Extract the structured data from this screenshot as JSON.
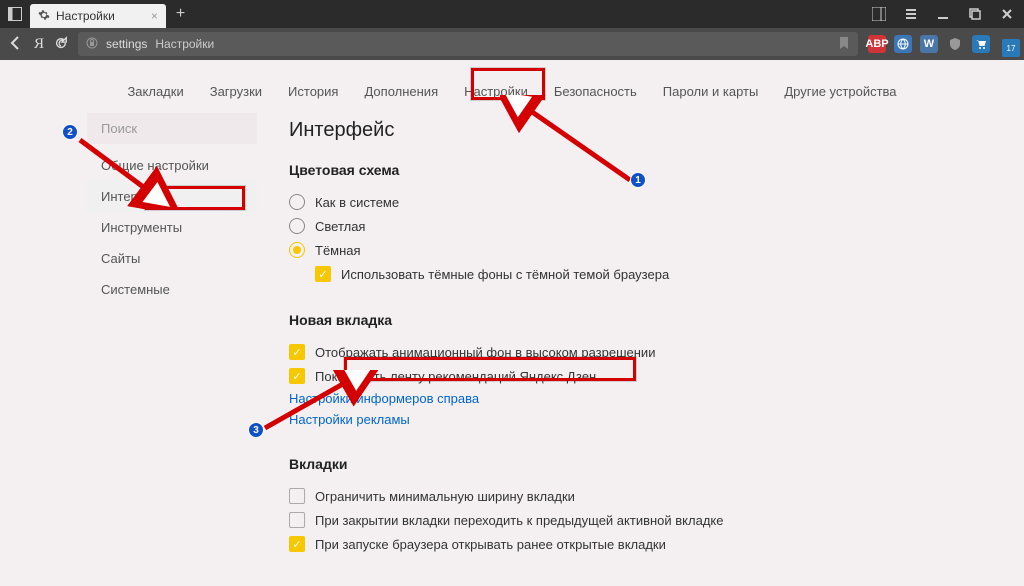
{
  "titlebar": {
    "tab_title": "Настройки",
    "dl_badge": "17"
  },
  "toolbar": {
    "omnibox_prefix": "settings",
    "omnibox_text": "Настройки",
    "yandex_letter": "Я",
    "vk": "W"
  },
  "topnav": {
    "bookmarks": "Закладки",
    "downloads": "Загрузки",
    "history": "История",
    "addons": "Дополнения",
    "settings": "Настройки",
    "security": "Безопасность",
    "passwords": "Пароли и карты",
    "devices": "Другие устройства"
  },
  "sidebar": {
    "search_placeholder": "Поиск",
    "general": "Общие настройки",
    "interface": "Интерфейс",
    "tools": "Инструменты",
    "sites": "Сайты",
    "system": "Системные"
  },
  "main": {
    "title": "Интерфейс",
    "scheme": {
      "heading": "Цветовая схема",
      "system": "Как в системе",
      "light": "Светлая",
      "dark": "Тёмная",
      "dark_bg": "Использовать тёмные фоны с тёмной темой браузера"
    },
    "newtab": {
      "heading": "Новая вкладка",
      "anim": "Отображать анимационный фон в высоком разрешении",
      "zen": "Показывать ленту рекомендаций Яндекс.Дзен",
      "informers": "Настройки информеров справа",
      "ads": "Настройки рекламы"
    },
    "tabs": {
      "heading": "Вкладки",
      "minwidth": "Ограничить минимальную ширину вкладки",
      "prev": "При закрытии вкладки переходить к предыдущей активной вкладке",
      "restore": "При запуске браузера открывать ранее открытые вкладки"
    }
  },
  "annotations": {
    "n1": "1",
    "n2": "2",
    "n3": "3"
  }
}
